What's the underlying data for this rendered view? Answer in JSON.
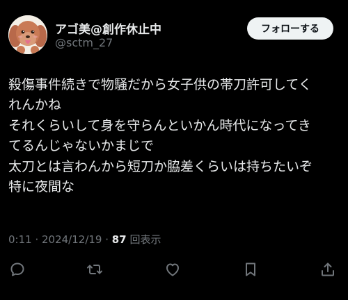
{
  "author": {
    "display_name": "アゴ美@創作休止中",
    "handle": "@sctm_27"
  },
  "follow_button": {
    "label": "フォローする"
  },
  "tweet": {
    "lines": [
      "殺傷事件続きで物騒だから女子供の帯刀許可してく",
      "れんかね",
      "それくらいして身を守らんといかん時代になってき",
      "てるんじゃないかまじで",
      "太刀とは言わんから短刀か脇差くらいは持ちたいぞ",
      "特に夜間な"
    ]
  },
  "meta": {
    "time": "0:11",
    "separator": " · ",
    "date": "2024/12/19",
    "view_count": "87",
    "view_label": "回表示"
  },
  "actions": [
    {
      "name": "reply",
      "icon": "reply-icon"
    },
    {
      "name": "retweet",
      "icon": "retweet-icon"
    },
    {
      "name": "like",
      "icon": "heart-icon"
    },
    {
      "name": "bookmark",
      "icon": "bookmark-icon"
    },
    {
      "name": "share",
      "icon": "share-icon"
    }
  ],
  "colors": {
    "background": "#000000",
    "text": "#e7e9ea",
    "secondary": "#71767b",
    "button_bg": "#eff3f4"
  }
}
